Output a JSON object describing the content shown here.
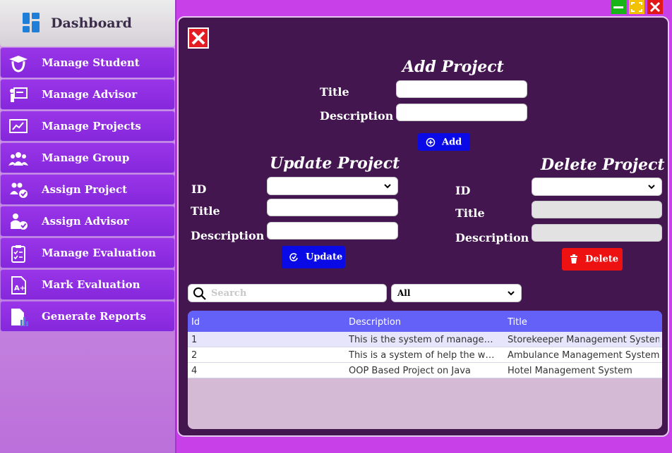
{
  "sidebar": {
    "header_title": "Dashboard",
    "items": [
      {
        "label": "Manage Student",
        "icon": "graduate-icon"
      },
      {
        "label": "Manage Advisor",
        "icon": "teacher-board-icon"
      },
      {
        "label": "Manage Projects",
        "icon": "chart-frame-icon"
      },
      {
        "label": "Manage Group",
        "icon": "group-icon"
      },
      {
        "label": "Assign Project",
        "icon": "users-check-icon"
      },
      {
        "label": "Assign Advisor",
        "icon": "user-check-icon"
      },
      {
        "label": "Manage Evaluation",
        "icon": "clipboard-icon"
      },
      {
        "label": "Mark Evaluation",
        "icon": "grade-document-icon"
      },
      {
        "label": "Generate Reports",
        "icon": "report-icon"
      }
    ]
  },
  "add_project": {
    "title": "Add Project",
    "title_label": "Title",
    "description_label": "Description",
    "title_value": "",
    "description_value": "",
    "add_button": "Add"
  },
  "update_project": {
    "title": "Update Project",
    "id_label": "ID",
    "title_label": "Title",
    "description_label": "Description",
    "id_value": "",
    "update_button": "Update"
  },
  "delete_project": {
    "title": "Delete Project",
    "id_label": "ID",
    "title_label": "Title",
    "description_label": "Description",
    "id_value": "",
    "delete_button": "Delete"
  },
  "search": {
    "placeholder": "Search",
    "filter_value": "All"
  },
  "table": {
    "columns": [
      "Id",
      "Description",
      "Title"
    ],
    "rows": [
      {
        "id": "1",
        "description": "This is the system of management...",
        "title": "Storekeeper Management System"
      },
      {
        "id": "2",
        "description": "This is a system of help the worke...",
        "title": "Ambulance Management System"
      },
      {
        "id": "4",
        "description": "OOP Based Project on Java",
        "title": "Hotel Management System"
      }
    ]
  },
  "colors": {
    "panel_bg": "#431650",
    "nav_bg": "#8a2be2",
    "add_button": "#0a0ae6",
    "update_button": "#0a0ae6",
    "delete_button": "#ee1111",
    "table_header": "#6461f8"
  }
}
